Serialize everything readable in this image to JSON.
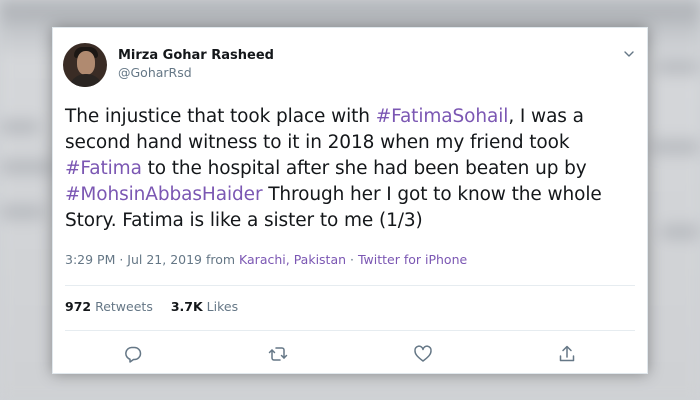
{
  "tweet": {
    "author_name": "Mirza Gohar Rasheed",
    "author_handle": "@GoharRsd",
    "text_parts": [
      {
        "t": "The injustice that took place with ",
        "tag": false
      },
      {
        "t": "#FatimaSohail",
        "tag": true
      },
      {
        "t": ", I was a second hand witness to it in 2018 when my friend took ",
        "tag": false
      },
      {
        "t": "#Fatima",
        "tag": true
      },
      {
        "t": " to the hospital after she had been beaten up by ",
        "tag": false
      },
      {
        "t": "#MohsinAbbasHaider",
        "tag": true
      },
      {
        "t": " Through her I got to know the whole Story. Fatima is like a sister to me (1/3)",
        "tag": false
      }
    ],
    "time": "3:29 PM · Jul 21, 2019 from ",
    "location": "Karachi, Pakistan",
    "separator": " · ",
    "source": "Twitter for iPhone",
    "retweets_count": "972",
    "retweets_label": "Retweets",
    "likes_count": "3.7K",
    "likes_label": "Likes"
  },
  "icons": {
    "reply": "reply-icon",
    "retweet": "retweet-icon",
    "like": "like-icon",
    "share": "share-icon",
    "menu": "chevron-down-icon"
  },
  "colors": {
    "hashtag": "#7b57b3",
    "text": "#14171a",
    "secondary": "#657786"
  }
}
